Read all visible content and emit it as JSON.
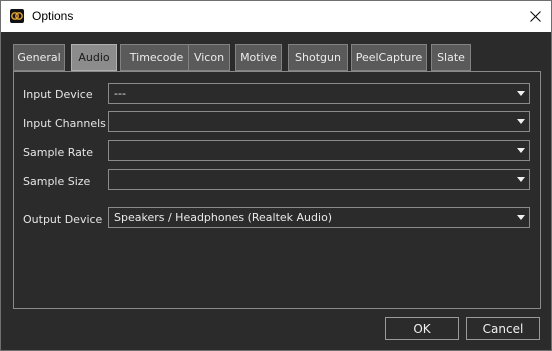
{
  "window": {
    "title": "Options",
    "app_icon": "pd-logo-icon",
    "close_icon": "close-icon"
  },
  "tabs": [
    {
      "label": "General",
      "active": false
    },
    {
      "label": "Audio",
      "active": true
    },
    {
      "label": "Timecode",
      "active": false
    },
    {
      "label": "Vicon",
      "active": false
    },
    {
      "label": "Motive",
      "active": false
    },
    {
      "label": "Shotgun",
      "active": false
    },
    {
      "label": "PeelCapture",
      "active": false
    },
    {
      "label": "Slate",
      "active": false
    }
  ],
  "audio": {
    "input_device": {
      "label": "Input Device",
      "value": "---"
    },
    "input_channels": {
      "label": "Input Channels",
      "value": ""
    },
    "sample_rate": {
      "label": "Sample Rate",
      "value": ""
    },
    "sample_size": {
      "label": "Sample Size",
      "value": ""
    },
    "output_device": {
      "label": "Output Device",
      "value": "Speakers / Headphones (Realtek Audio)"
    }
  },
  "buttons": {
    "ok": "OK",
    "cancel": "Cancel"
  },
  "colors": {
    "background": "#2b2b2b",
    "titlebar": "#ffffff",
    "active_tab": "#8c8c8c",
    "inactive_tab": "#5a5a5a",
    "border": "#8a8a8a"
  }
}
